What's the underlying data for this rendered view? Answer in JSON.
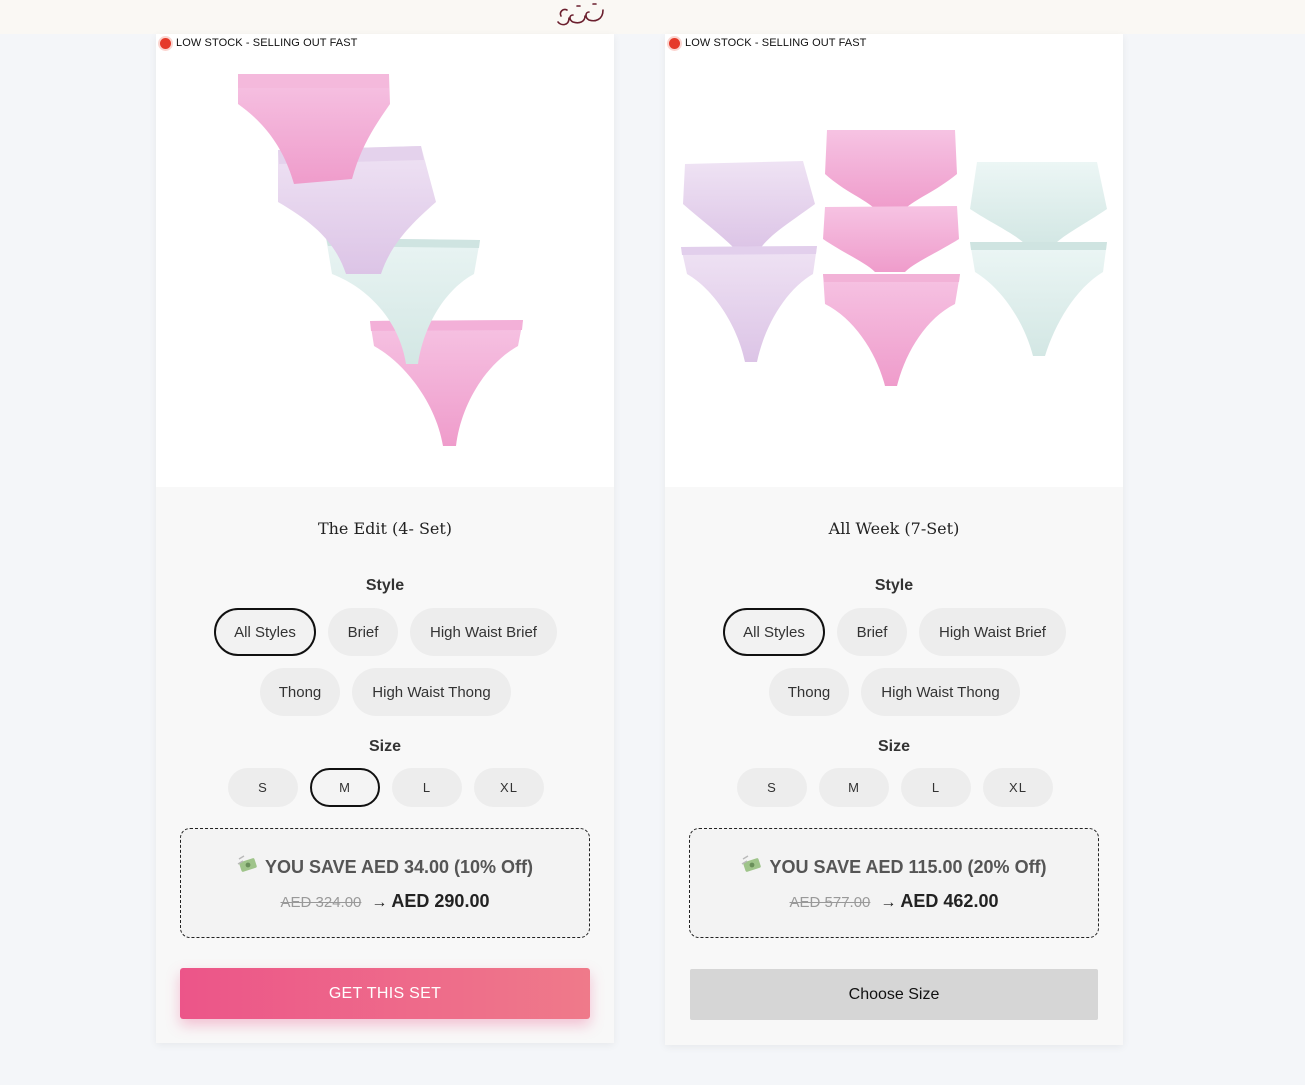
{
  "header": {
    "logo_text": "غنج"
  },
  "colors": {
    "pink": "#f3b6dc",
    "lavender": "#e7d4ee",
    "mint": "#dcefed",
    "cta": "#ec5589",
    "stock_dot": "#e53a2a"
  },
  "cards": [
    {
      "stock_text": "LOW STOCK - SELLING OUT FAST",
      "title": "The Edit (4- Set)",
      "style_label": "Style",
      "styles": [
        "All Styles",
        "Brief",
        "High Waist Brief",
        "Thong",
        "High Waist Thong"
      ],
      "selected_style": "All Styles",
      "size_label": "Size",
      "sizes": [
        "S",
        "M",
        "L",
        "XL"
      ],
      "selected_size": "M",
      "save_icon": "money-with-wings-icon",
      "save_text": "YOU SAVE AED 34.00 (10% Off)",
      "old_price": "AED 324.00",
      "arrow": "→",
      "new_price": "AED 290.00",
      "cta_label": "GET THIS SET"
    },
    {
      "stock_text": "LOW STOCK - SELLING OUT FAST",
      "title": "All Week (7-Set)",
      "style_label": "Style",
      "styles": [
        "All Styles",
        "Brief",
        "High Waist Brief",
        "Thong",
        "High Waist Thong"
      ],
      "selected_style": "All Styles",
      "size_label": "Size",
      "sizes": [
        "S",
        "M",
        "L",
        "XL"
      ],
      "selected_size": "",
      "save_icon": "money-with-wings-icon",
      "save_text": "YOU SAVE AED 115.00 (20% Off)",
      "old_price": "AED 577.00",
      "arrow": "→",
      "new_price": "AED 462.00",
      "cta_label": "Choose Size"
    }
  ]
}
